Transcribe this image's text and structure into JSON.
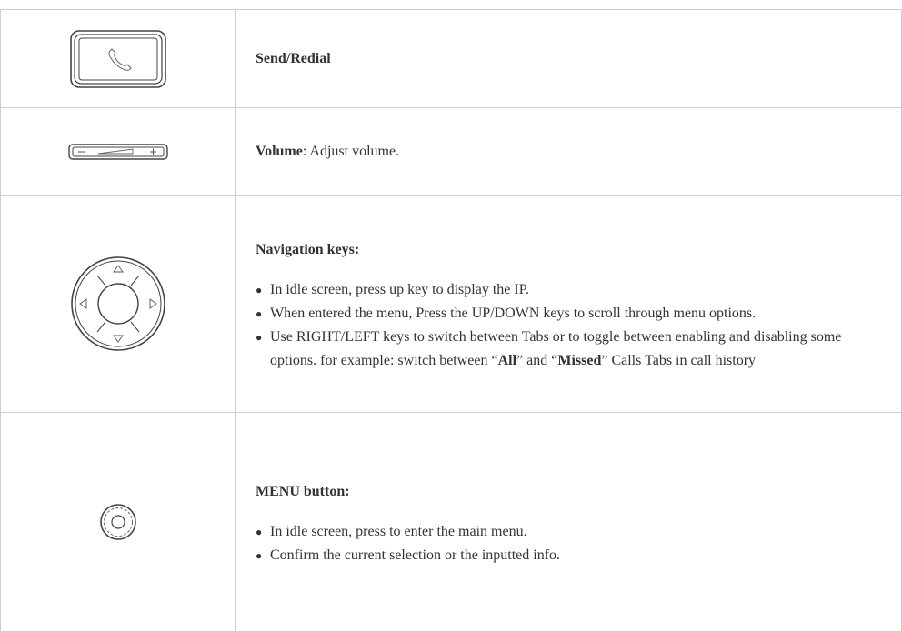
{
  "rows": {
    "send": {
      "icon": "phone-handset-key-icon",
      "title": "Send/Redial"
    },
    "volume": {
      "icon": "volume-rocker-icon",
      "title": "Volume",
      "desc": ": Adjust volume."
    },
    "navigation": {
      "icon": "navigation-pad-icon",
      "title": "Navigation keys:",
      "bullets": [
        "In idle screen, press up key to display the IP.",
        "When entered the menu, Press the UP/DOWN keys to scroll through menu options."
      ],
      "bullet3": {
        "before": "Use RIGHT/LEFT keys to switch between Tabs or to toggle between enabling and disabling some options. for example: switch between “",
        "all": "All",
        "middle": "” and “",
        "missed": "Missed",
        "after": "” Calls Tabs in call history"
      }
    },
    "menu": {
      "icon": "menu-button-icon",
      "title": "MENU button:",
      "bullets": [
        "In idle screen, press to enter the main menu.",
        "Confirm the current selection or the inputted info."
      ]
    }
  }
}
